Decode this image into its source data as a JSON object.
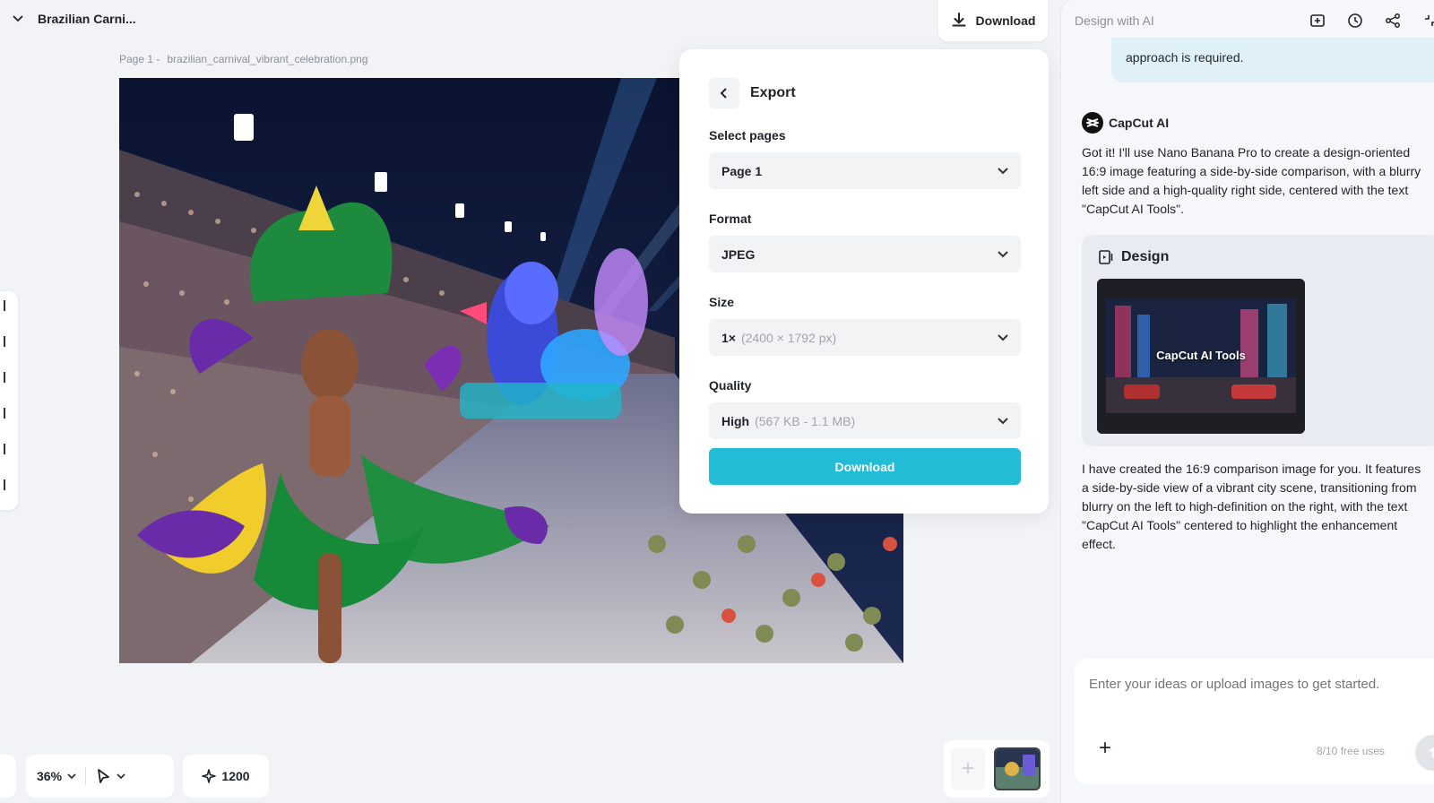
{
  "header": {
    "doc_title": "Brazilian Carni...",
    "download_label": "Download"
  },
  "canvas": {
    "page_label": "Page 1 -",
    "file_name": "brazilian_carnival_vibrant_celebration.png"
  },
  "export": {
    "title": "Export",
    "select_pages_label": "Select pages",
    "select_pages_value": "Page 1",
    "format_label": "Format",
    "format_value": "JPEG",
    "size_label": "Size",
    "size_value": "1×",
    "size_detail": "(2400 × 1792 px)",
    "quality_label": "Quality",
    "quality_value": "High",
    "quality_detail": "(567 KB - 1.1 MB)",
    "download_label": "Download",
    "accent_color": "#22bcd6"
  },
  "bottom": {
    "zoom": "36%",
    "credits": "1200"
  },
  "ai": {
    "title": "Design with AI",
    "user_bubble": "approach is required.",
    "assistant_name": "CapCut AI",
    "message1": "Got it! I'll use Nano Banana Pro to create a design-oriented 16:9 image featuring a side-by-side comparison, with a blurry left side and a high-quality right side, centered with the text \"CapCut AI Tools\".",
    "design_label": "Design",
    "design_thumb_text": "CapCut AI Tools",
    "message2": "I have created the 16:9 comparison image for you. It features a side-by-side view of a vibrant city scene, transitioning from blurry on the left to high-definition on the right, with the text \"CapCut AI Tools\" centered to highlight the enhancement effect.",
    "input_placeholder": "Enter your ideas or upload images to get started.",
    "free_uses": "8/10 free uses"
  }
}
